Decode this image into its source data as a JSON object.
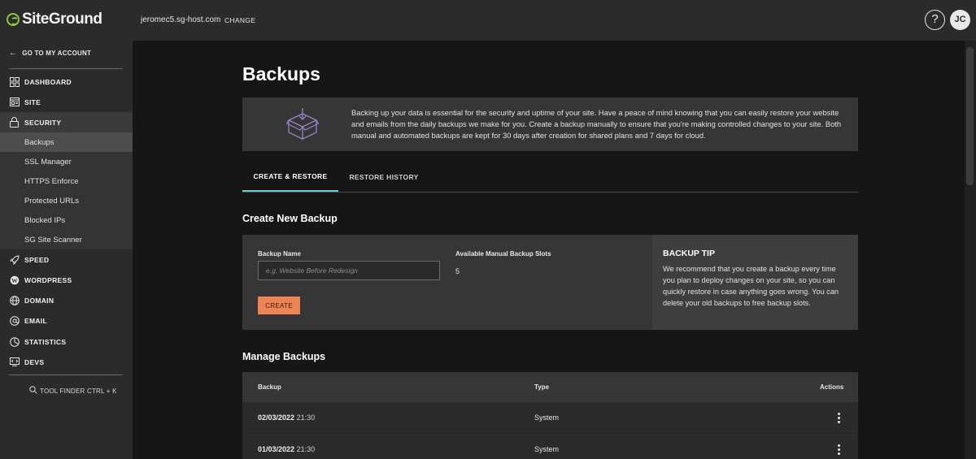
{
  "topbar": {
    "logo_text": "SiteGround",
    "domain": "jeromec5.sg-host.com",
    "change_label": "CHANGE",
    "help_label": "?",
    "avatar_initials": "JC"
  },
  "sidebar": {
    "back_label": "GO TO MY ACCOUNT",
    "items": [
      {
        "label": "DASHBOARD",
        "icon": "dashboard-icon"
      },
      {
        "label": "SITE",
        "icon": "site-icon"
      },
      {
        "label": "SECURITY",
        "icon": "lock-icon"
      },
      {
        "label": "SPEED",
        "icon": "rocket-icon"
      },
      {
        "label": "WORDPRESS",
        "icon": "wordpress-icon"
      },
      {
        "label": "DOMAIN",
        "icon": "globe-icon"
      },
      {
        "label": "EMAIL",
        "icon": "email-icon"
      },
      {
        "label": "STATISTICS",
        "icon": "pie-chart-icon"
      },
      {
        "label": "DEVS",
        "icon": "code-icon"
      }
    ],
    "security_sub": [
      "Backups",
      "SSL Manager",
      "HTTPS Enforce",
      "Protected URLs",
      "Blocked IPs",
      "SG Site Scanner"
    ],
    "active_sub": "Backups",
    "tool_finder": "TOOL FINDER CTRL + K"
  },
  "main": {
    "title": "Backups",
    "info_text": "Backing up your data is essential for the security and uptime of your site. Have a peace of mind knowing that you can easily restore your website and emails from the daily backups we make for you. Create a backup manually to ensure that you're making controlled changes to your site. Both manual and automated backups are kept for 30 days after creation for shared plans and 7 days for cloud.",
    "tabs": [
      "CREATE & RESTORE",
      "RESTORE HISTORY"
    ],
    "create_heading": "Create New Backup",
    "backup_name_label": "Backup Name",
    "backup_name_placeholder": "e.g. Website Before Redesign",
    "slots_label": "Available Manual Backup Slots",
    "slots_value": "5",
    "create_button": "CREATE",
    "tip_title": "BACKUP TIP",
    "tip_text": "We recommend that you create a backup every time you plan to deploy changes on your site, so you can quickly restore in case anything goes wrong. You can delete your old backups to free backup slots.",
    "manage_heading": "Manage Backups",
    "table_headers": [
      "Backup",
      "Type",
      "Actions"
    ],
    "rows": [
      {
        "date": "02/03/2022",
        "time": "21:30",
        "type": "System"
      },
      {
        "date": "01/03/2022",
        "time": "21:30",
        "type": "System"
      }
    ]
  },
  "colors": {
    "accent_button": "#ee8354",
    "tab_underline": "#6cc9c8",
    "logo_green": "#8dc63f"
  }
}
